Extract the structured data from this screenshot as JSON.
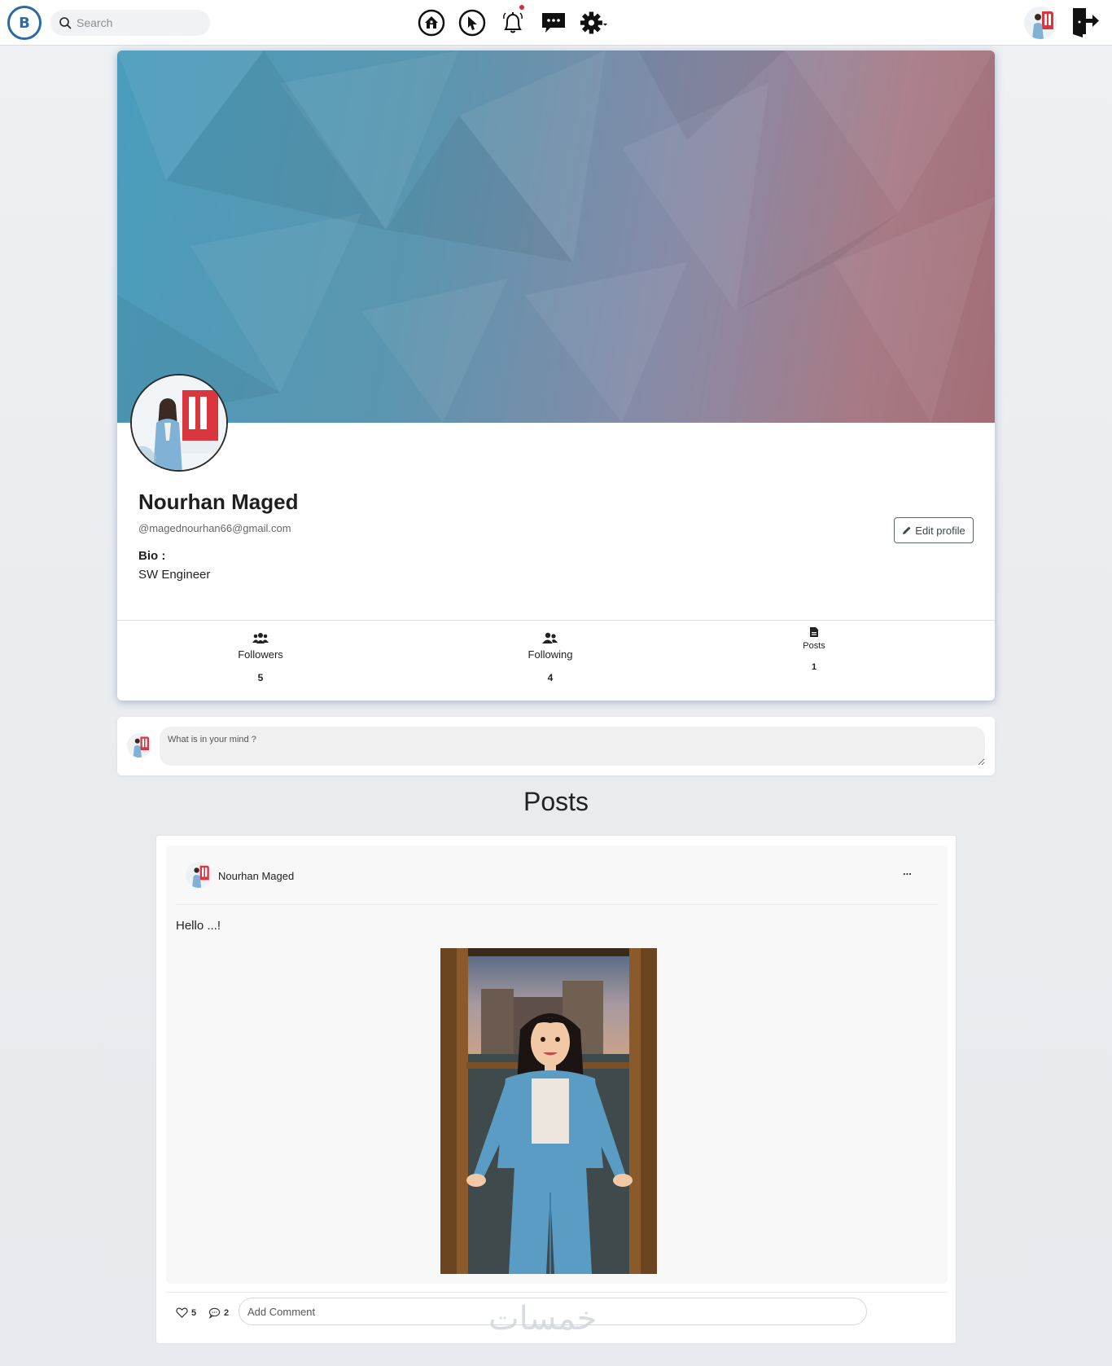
{
  "nav": {
    "logo_text": "B",
    "search_placeholder": "Search",
    "icons": [
      "home-icon",
      "explore-icon",
      "bell-icon",
      "messages-icon",
      "settings-icon"
    ],
    "notification_dot_color": "#e0283a",
    "user_avatar": "profile-photo",
    "logout_icon": "logout-icon"
  },
  "profile": {
    "name": "Nourhan Maged",
    "email": "@magednourhan66@gmail.com",
    "bio_label": "Bio :",
    "bio": "SW Engineer",
    "edit_label": "Edit profile",
    "stats": [
      {
        "label": "Followers",
        "count": "5",
        "icon": "followers-icon"
      },
      {
        "label": "Following",
        "count": "4",
        "icon": "following-icon"
      },
      {
        "label": "Posts",
        "count": "1",
        "icon": "posts-icon"
      }
    ]
  },
  "composer": {
    "placeholder": "What is in your mind ?"
  },
  "posts_heading": "Posts",
  "post": {
    "author": "Nourhan Maged",
    "more": "...",
    "text": "Hello ...!",
    "likes": "5",
    "comments": "2",
    "comment_placeholder": "Add Comment"
  },
  "watermark": "خمسات",
  "colors": {
    "accent": "#2b6aa3",
    "cover_start": "#4a9dbd",
    "cover_end": "#a36d75",
    "notification": "#e0283a"
  }
}
